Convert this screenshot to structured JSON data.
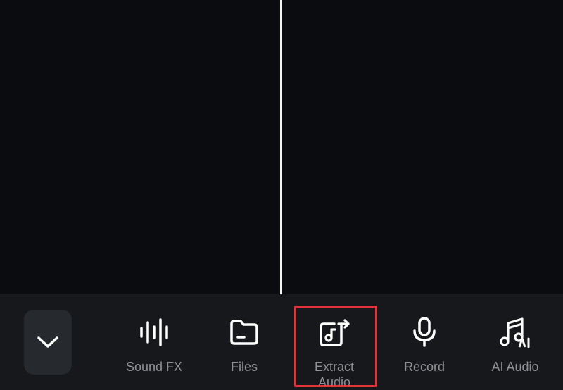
{
  "toolbar": {
    "collapse_icon": "chevron-down-icon",
    "items": [
      {
        "label": "Sound FX",
        "icon": "sound-wave-icon"
      },
      {
        "label": "Files",
        "icon": "folder-icon"
      },
      {
        "label": "Extract\nAudio",
        "icon": "extract-audio-icon"
      },
      {
        "label": "Record",
        "icon": "microphone-icon"
      },
      {
        "label": "AI Audio",
        "icon": "ai-music-icon"
      }
    ],
    "highlight_color": "#e0343a"
  }
}
